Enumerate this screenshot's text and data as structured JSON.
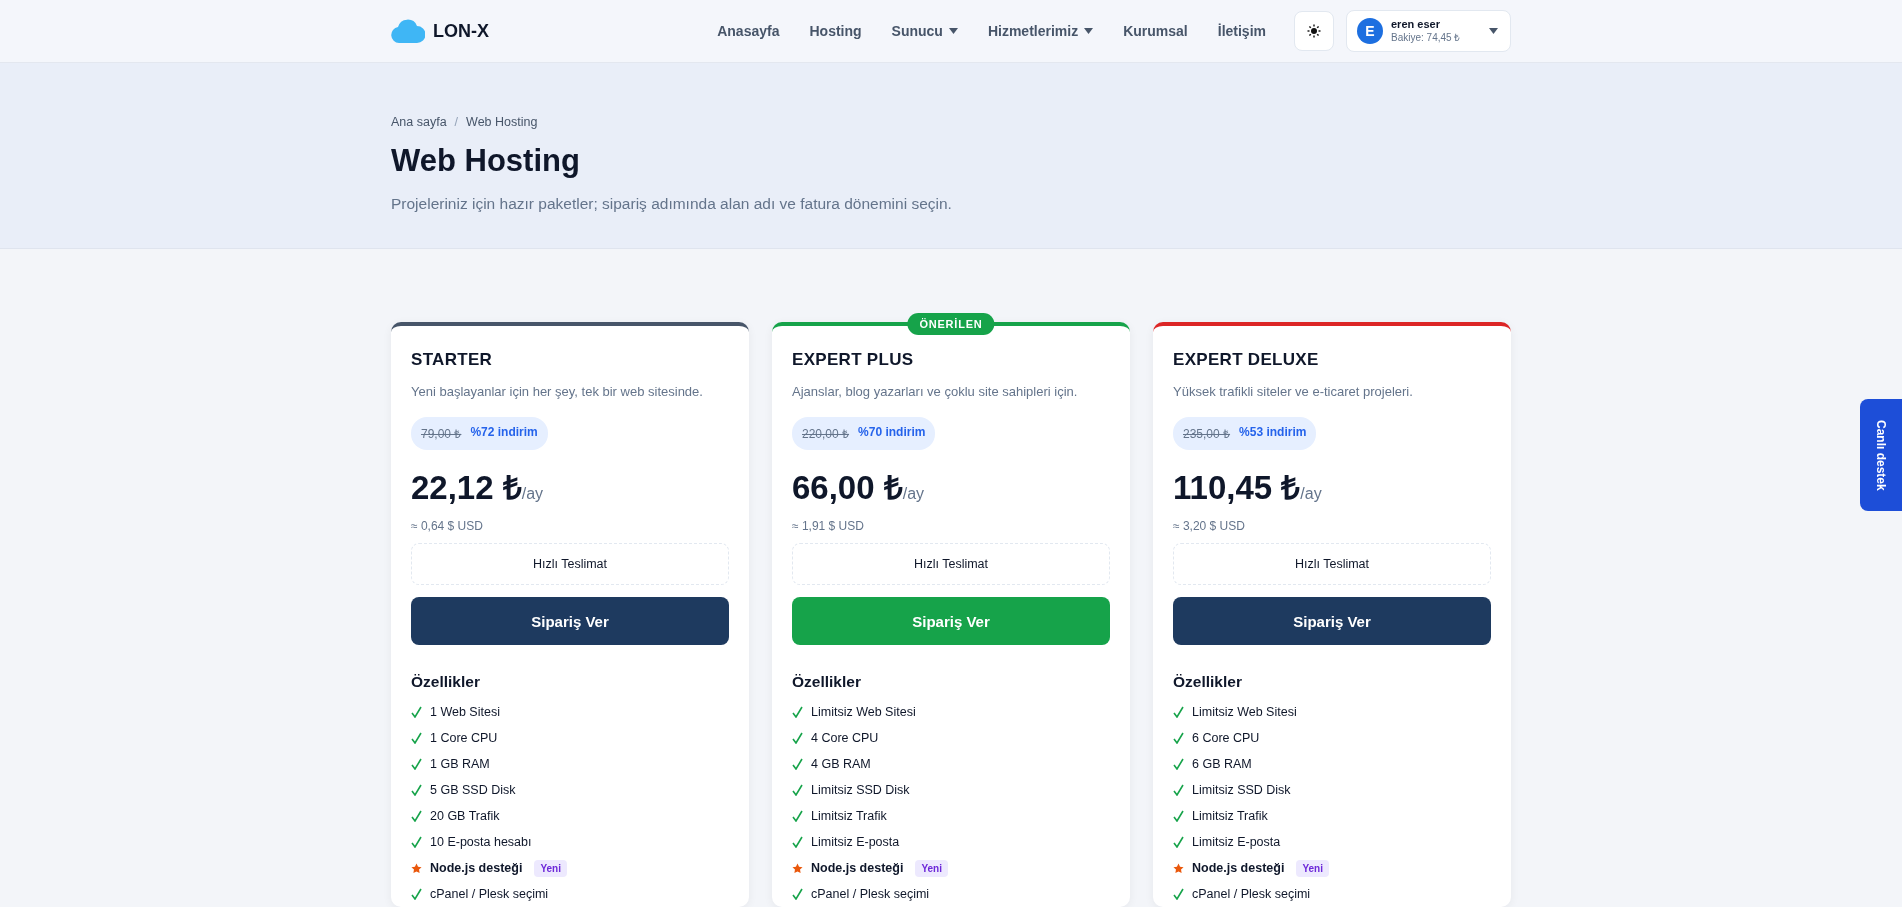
{
  "header": {
    "logo": "LON-X",
    "nav": [
      {
        "label": "Anasayfa",
        "dropdown": false
      },
      {
        "label": "Hosting",
        "dropdown": false
      },
      {
        "label": "Sunucu",
        "dropdown": true
      },
      {
        "label": "Hizmetlerimiz",
        "dropdown": true
      },
      {
        "label": "Kurumsal",
        "dropdown": false
      },
      {
        "label": "İletişim",
        "dropdown": false
      }
    ],
    "user": {
      "initial": "E",
      "name": "eren eser",
      "balance": "Bakiye: 74,45 ₺"
    }
  },
  "breadcrumb": [
    "Ana sayfa",
    "Web Hosting"
  ],
  "breadcrumb_separator": "/",
  "title": "Web Hosting",
  "subtitle": "Projeleriniz için hazır paketler; sipariş adımında alan adı ve fatura dönemini seçin.",
  "plans": [
    {
      "name": "STARTER",
      "color": "#475569",
      "recommended": false,
      "description": "Yeni başlayanlar için her şey, tek bir web sitesinde.",
      "old_price": "79,00 ₺",
      "discount": "%72 indirim",
      "price": "22,12 ₺",
      "period": "/ay",
      "usd": "≈ 0,64 $ USD",
      "delivery": "Hızlı Teslimat",
      "button": "Sipariş Ver",
      "features_title": "Özellikler",
      "features": [
        {
          "kind": "check",
          "text": "1 Web Sitesi"
        },
        {
          "kind": "check",
          "text": "1 Core CPU"
        },
        {
          "kind": "check",
          "text": "1 GB RAM"
        },
        {
          "kind": "check",
          "text": "5 GB SSD Disk"
        },
        {
          "kind": "check",
          "text": "20 GB Trafik"
        },
        {
          "kind": "check",
          "text": "10 E-posta hesabı"
        },
        {
          "kind": "star",
          "text": "Node.js desteği",
          "badge": "Yeni"
        },
        {
          "kind": "check",
          "text": "cPanel / Plesk seçimi"
        }
      ]
    },
    {
      "name": "EXPERT PLUS",
      "color": "#16a34a",
      "recommended": true,
      "ribbon": "ÖNERİLEN",
      "description": "Ajanslar, blog yazarları ve çoklu site sahipleri için.",
      "old_price": "220,00 ₺",
      "discount": "%70 indirim",
      "price": "66,00 ₺",
      "period": "/ay",
      "usd": "≈ 1,91 $ USD",
      "delivery": "Hızlı Teslimat",
      "button": "Sipariş Ver",
      "features_title": "Özellikler",
      "features": [
        {
          "kind": "check",
          "text": "Limitsiz Web Sitesi"
        },
        {
          "kind": "check",
          "text": "4 Core CPU"
        },
        {
          "kind": "check",
          "text": "4 GB RAM"
        },
        {
          "kind": "check",
          "text": "Limitsiz SSD Disk"
        },
        {
          "kind": "check",
          "text": "Limitsiz Trafik"
        },
        {
          "kind": "check",
          "text": "Limitsiz E-posta"
        },
        {
          "kind": "star",
          "text": "Node.js desteği",
          "badge": "Yeni"
        },
        {
          "kind": "check",
          "text": "cPanel / Plesk seçimi"
        }
      ]
    },
    {
      "name": "EXPERT DELUXE",
      "color": "#dc2626",
      "recommended": false,
      "description": "Yüksek trafikli siteler ve e-ticaret projeleri.",
      "old_price": "235,00 ₺",
      "discount": "%53 indirim",
      "price": "110,45 ₺",
      "period": "/ay",
      "usd": "≈ 3,20 $ USD",
      "delivery": "Hızlı Teslimat",
      "button": "Sipariş Ver",
      "features_title": "Özellikler",
      "features": [
        {
          "kind": "check",
          "text": "Limitsiz Web Sitesi"
        },
        {
          "kind": "check",
          "text": "6 Core CPU"
        },
        {
          "kind": "check",
          "text": "6 GB RAM"
        },
        {
          "kind": "check",
          "text": "Limitsiz SSD Disk"
        },
        {
          "kind": "check",
          "text": "Limitsiz Trafik"
        },
        {
          "kind": "check",
          "text": "Limitsiz E-posta"
        },
        {
          "kind": "star",
          "text": "Node.js desteği",
          "badge": "Yeni"
        },
        {
          "kind": "check",
          "text": "cPanel / Plesk seçimi"
        }
      ]
    }
  ],
  "live_support": "Canlı destek"
}
